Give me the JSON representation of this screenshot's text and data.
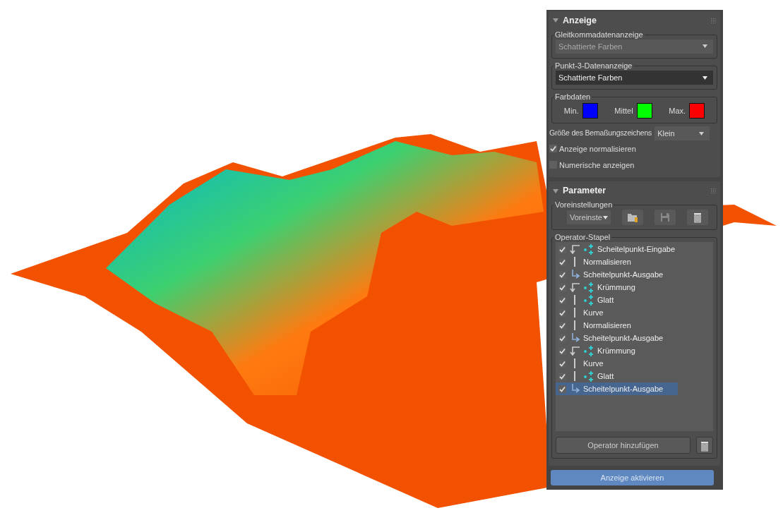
{
  "display_rollout": {
    "title": "Anzeige",
    "expanded": true,
    "float_display": {
      "legend": "Gleitkommadatenanzeige",
      "value": "Schattierte Farben",
      "disabled": true
    },
    "point3_display": {
      "legend": "Punkt-3-Datenanzeige",
      "value": "Schattierte Farben",
      "disabled": false
    },
    "color_data": {
      "legend": "Farbdaten",
      "swatches": [
        {
          "label": "Min.",
          "color": "#0000ff"
        },
        {
          "label": "Mittel",
          "color": "#00ff00"
        },
        {
          "label": "Max.",
          "color": "#ff0000"
        }
      ]
    },
    "marker_size": {
      "label": "Größe des Bemaßungszeichens",
      "value": "Klein"
    },
    "checkboxes": [
      {
        "label": "Anzeige normalisieren",
        "checked": true
      },
      {
        "label": "Numerische anzeigen",
        "checked": false
      }
    ]
  },
  "parameter_rollout": {
    "title": "Parameter",
    "expanded": true,
    "presets": {
      "legend": "Voreinstellungen",
      "dropdown": "Voreinste"
    },
    "operator_stack": {
      "legend": "Operator-Stapel",
      "items": [
        {
          "label": "Scheitelpunkt-Eingabe",
          "kind": "branch",
          "points_icon": true,
          "checked": true,
          "selected": false
        },
        {
          "label": "Normalisieren",
          "kind": "bar",
          "points_icon": false,
          "checked": true,
          "selected": false
        },
        {
          "label": "Scheitelpunkt-Ausgabe",
          "kind": "end",
          "points_icon": false,
          "checked": true,
          "selected": false
        },
        {
          "label": "Krümmung",
          "kind": "branch",
          "points_icon": true,
          "checked": true,
          "selected": false
        },
        {
          "label": "Glatt",
          "kind": "bar",
          "points_icon": true,
          "checked": true,
          "selected": false
        },
        {
          "label": "Kurve",
          "kind": "bar",
          "points_icon": false,
          "checked": true,
          "selected": false
        },
        {
          "label": "Normalisieren",
          "kind": "bar",
          "points_icon": false,
          "checked": true,
          "selected": false
        },
        {
          "label": "Scheitelpunkt-Ausgabe",
          "kind": "end",
          "points_icon": false,
          "checked": true,
          "selected": false
        },
        {
          "label": "Krümmung",
          "kind": "branch",
          "points_icon": true,
          "checked": true,
          "selected": false
        },
        {
          "label": "Kurve",
          "kind": "bar",
          "points_icon": false,
          "checked": true,
          "selected": false
        },
        {
          "label": "Glatt",
          "kind": "bar",
          "points_icon": true,
          "checked": true,
          "selected": false
        },
        {
          "label": "Scheitelpunkt-Ausgabe",
          "kind": "end",
          "points_icon": false,
          "checked": true,
          "selected": true
        }
      ],
      "add_button": "Operator hinzufügen"
    }
  },
  "activate_button": "Anzeige aktivieren"
}
